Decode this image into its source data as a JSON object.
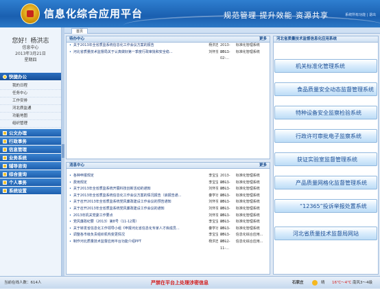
{
  "header": {
    "title": "信息化综合应用平台",
    "slogan": "规范管理 提升效能 资源共享",
    "links": "系统所有功能 | 退出"
  },
  "tabs": [
    "首页"
  ],
  "user": {
    "greeting": "您好！杨洪志",
    "org": "信息中心",
    "date": "2013年3月21日",
    "weekday": "星期四"
  },
  "sidebar": {
    "quick": {
      "label": "快捷办公",
      "items": [
        "我的日程",
        "任务中心",
        "工作安排",
        "河北质监通",
        "功能地图",
        "组织管理"
      ]
    },
    "menus": [
      "公文办理",
      "行政事务",
      "信息管理",
      "业务系统",
      "辅导咨询",
      "综合查询",
      "个人事务",
      "系统设置"
    ]
  },
  "todo": {
    "title": "待办中心",
    "more": "更多",
    "rows": [
      {
        "t": "关于2013年全省质监系统信息化工作会议方案的报告",
        "p": "杨洪志",
        "d": "2013-03-...",
        "s": "标准化管理系统"
      },
      {
        "t": "河北省质量技术监督局关于认真做好第一季度行政审批和安全稳...",
        "p": "刘怀芬",
        "d": "2013-02-...",
        "s": "标准化管理系统"
      }
    ]
  },
  "messages": {
    "title": "消息中心",
    "more": "更多",
    "rows": [
      {
        "t": "各种申报规定",
        "p": "李宝宝",
        "d": "2013-03-...",
        "s": "标准化管理系统"
      },
      {
        "t": "费用规定",
        "p": "李宝宝",
        "d": "2013-03-...",
        "s": "标准化管理系统"
      },
      {
        "t": "关于2013年全省质监系统开展科技创新活动的通知",
        "p": "刘怀芬",
        "d": "2013-03-...",
        "s": "标准化管理系统"
      },
      {
        "t": "关于2013年全省质监系统信息化工作会议方案的情况报告（启报告通...",
        "p": "秦学功",
        "d": "2013-03-...",
        "s": "标准化管理系统"
      },
      {
        "t": "关于召开2013年全省质监系统党风廉政建设工作会议的预告通知",
        "p": "刘怀芬",
        "d": "2013-03-...",
        "s": "标准化管理系统"
      },
      {
        "t": "关于召开2013年全省质监系统党风廉政建设工作会议的通知",
        "p": "刘怀芬",
        "d": "2013-03-...",
        "s": "标准化管理系统"
      },
      {
        "t": "2013年机关党委工作要点",
        "p": "刘怀芬",
        "d": "2013-03-...",
        "s": "标准化管理系统"
      },
      {
        "t": "党风廉政纪要（2013）第8号（11-12周）",
        "p": "李宝宝",
        "d": "2013-03-...",
        "s": "标准化管理系统"
      },
      {
        "t": "关于转发省信息化工作领导小组《申报河北省信息化专家人才库成员...",
        "p": "秦学功",
        "d": "2013-03-...",
        "s": "标准化管理系统"
      },
      {
        "t": "调整各市级负责组织机构变更情况",
        "p": "李宝宝",
        "d": "2013-03-...",
        "s": "信息化综合应用..."
      },
      {
        "t": "制作河北质量技术监督应用平台功能介绍PPT",
        "p": "杨洪志",
        "d": "2012-11-...",
        "s": "信息化综合应用..."
      }
    ]
  },
  "systems": {
    "title": "河北省质量技术监督信息化应用系统",
    "buttons": [
      "机关标准化管理系统",
      "食品质量安全动态监督管理系统",
      "特种设备安全监察检验系统",
      "行政许可审批电子监察系统",
      "获证实验室监督管理系统",
      "产品质量网格化监督管理系统",
      "“12365”投诉举报处置系统",
      "河北省质量技术监督局网站"
    ]
  },
  "status": {
    "online": "当前在线人数：614人",
    "warning": "严禁在平台上处理涉密信息",
    "city": "石家庄",
    "weather": "晴",
    "temp": "16℃～4℃",
    "wind": "南风3～4级"
  }
}
